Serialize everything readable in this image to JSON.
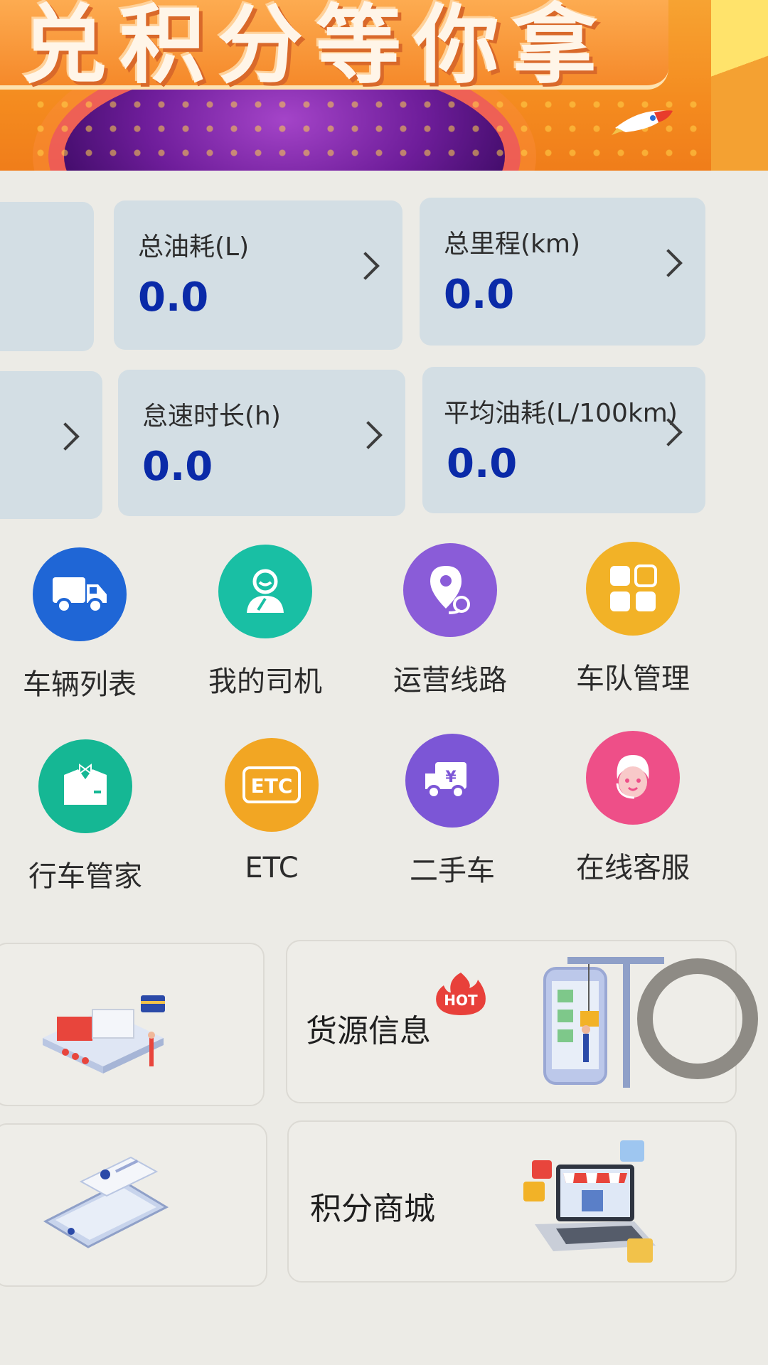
{
  "banner": {
    "slogan": "兑积分等你拿"
  },
  "stats": [
    {
      "label": "总油耗(L)",
      "value": "0.0"
    },
    {
      "label": "总里程(km)",
      "value": "0.0"
    },
    {
      "label": "怠速时长(h)",
      "value": "0.0"
    },
    {
      "label": "平均油耗(L/100km)",
      "value": "0.0"
    }
  ],
  "grid": [
    {
      "label": "车辆列表",
      "icon": "truck-icon",
      "color": "#1f66d6"
    },
    {
      "label": "我的司机",
      "icon": "driver-icon",
      "color": "#19bfa4"
    },
    {
      "label": "运营线路",
      "icon": "route-pin-icon",
      "color": "#8a5cd8"
    },
    {
      "label": "车队管理",
      "icon": "grid-apps-icon",
      "color": "#f2b227"
    },
    {
      "label": "行车管家",
      "icon": "butler-icon",
      "color": "#15b794"
    },
    {
      "label": "ETC",
      "icon": "etc-icon",
      "color": "#f2a623"
    },
    {
      "label": "二手车",
      "icon": "used-truck-icon",
      "color": "#7c56d6"
    },
    {
      "label": "在线客服",
      "icon": "customer-service-icon",
      "color": "#ee4f88"
    }
  ],
  "services": {
    "cargo_label": "货源信息",
    "hot_badge": "HOT",
    "mall_label": "积分商城"
  }
}
